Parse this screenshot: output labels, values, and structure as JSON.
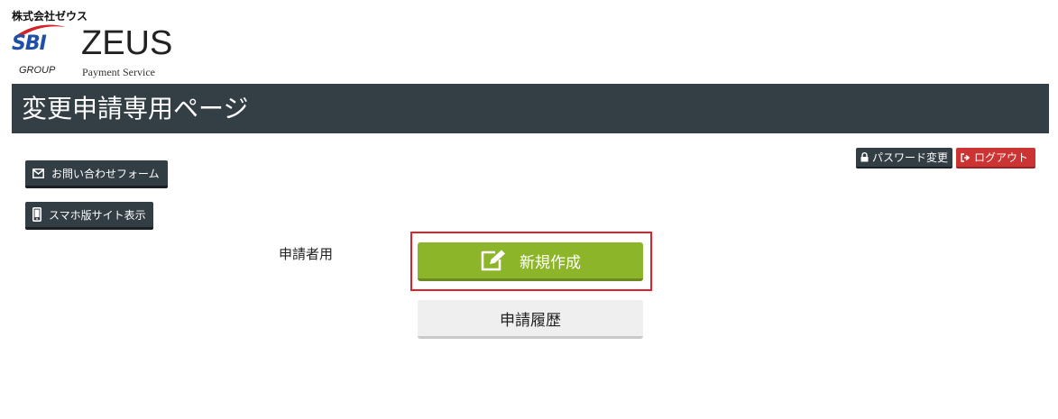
{
  "header": {
    "company_name": "株式会社ゼウス",
    "logo": {
      "sbi": "SBI",
      "group": "GROUP",
      "zeus": "ZEUS",
      "payment_service": "Payment Service"
    },
    "page_title": "変更申請専用ページ"
  },
  "left_buttons": {
    "contact_label": "お問い合わせフォーム",
    "mobile_label": "スマホ版サイト表示"
  },
  "top_right_buttons": {
    "password_label": "パスワード変更",
    "logout_label": "ログアウト"
  },
  "main": {
    "applicant_label": "申請者用",
    "create_label": "新規作成",
    "history_label": "申請履歴"
  },
  "icons": {
    "contact": "envelope-icon",
    "mobile": "smartphone-icon",
    "password": "lock-icon",
    "logout": "sign-out-icon",
    "create": "edit-icon"
  },
  "colors": {
    "title_bar": "#343f45",
    "create_button": "#8db52a",
    "logout_button": "#cc3333",
    "highlight": "#e0202a",
    "sbi_blue": "#1f4fa6",
    "sbi_red": "#d2232a"
  }
}
